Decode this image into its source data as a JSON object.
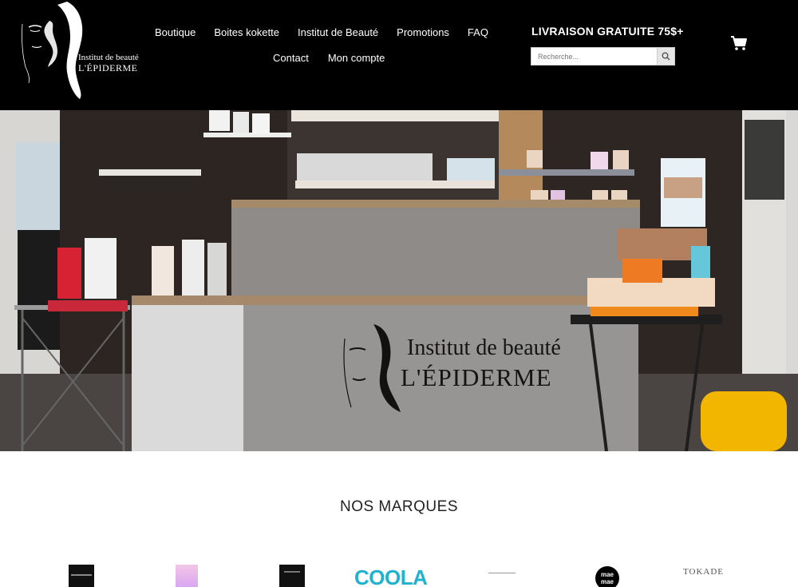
{
  "brand": {
    "line1": "Institut de beauté",
    "line2": "L'ÉPIDERME"
  },
  "nav": {
    "row1": [
      "Boutique",
      "Boites kokette",
      "Institut de Beauté",
      "Promotions",
      "FAQ"
    ],
    "row2": [
      "Contact",
      "Mon compte"
    ]
  },
  "promo": "LIVRAISON GRATUITE 75$+",
  "search": {
    "placeholder": "Recherche..."
  },
  "hero": {
    "sign_line1": "Institut de beauté",
    "sign_line2": "L'ÉPIDERME"
  },
  "brands": {
    "title": "NOS MARQUES",
    "coola": "COOLA",
    "maemae": "mae mae",
    "tokade": "TOKADE"
  },
  "colors": {
    "header_bg": "#000000",
    "coola": "#1fb3cf",
    "accent_yellow": "#f0b400"
  }
}
